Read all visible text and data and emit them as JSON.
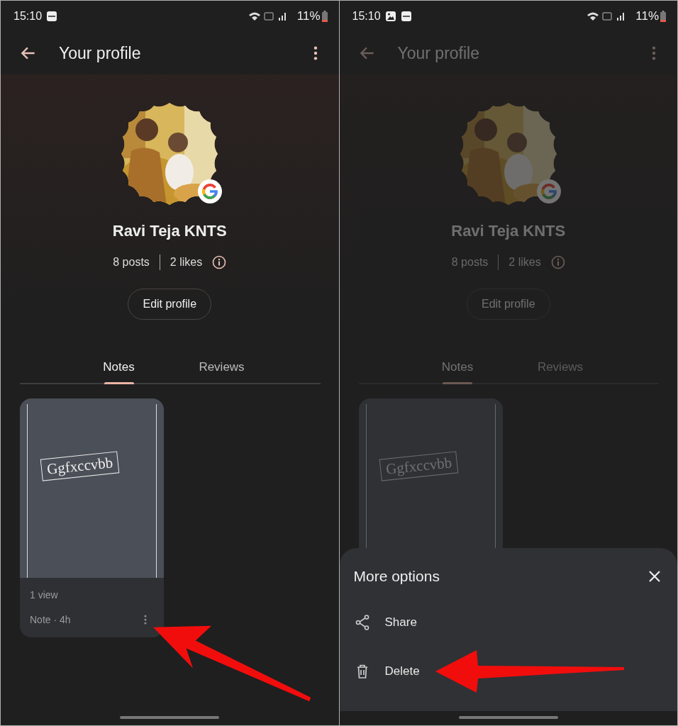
{
  "panels": [
    {
      "dimmed": false,
      "status_bar": {
        "time": "15:10",
        "notification_icons": [
          {
            "kind": "app"
          }
        ],
        "battery": "11%"
      },
      "app_bar": {
        "title": "Your profile"
      },
      "profile": {
        "name": "Ravi Teja KNTS",
        "posts": "8 posts",
        "likes": "2 likes",
        "edit_button": "Edit profile"
      },
      "tabs": [
        {
          "label": "Notes",
          "selected": true
        },
        {
          "label": "Reviews",
          "selected": false
        }
      ],
      "notes": [
        {
          "preview_text": "Ggfxccvbb",
          "views": "1 view",
          "meta": "Note · 4h"
        }
      ]
    },
    {
      "dimmed": true,
      "status_bar": {
        "time": "15:10",
        "notification_icons": [
          {
            "kind": "gallery"
          },
          {
            "kind": "app"
          }
        ],
        "battery": "11%"
      },
      "app_bar": {
        "title": "Your profile"
      },
      "profile": {
        "name": "Ravi Teja KNTS",
        "posts": "8 posts",
        "likes": "2 likes",
        "edit_button": "Edit profile"
      },
      "tabs": [
        {
          "label": "Notes",
          "selected": true
        },
        {
          "label": "Reviews",
          "selected": false
        }
      ],
      "notes": [
        {
          "preview_text": "Ggfxccvbb"
        }
      ],
      "sheet": {
        "title": "More options",
        "items": [
          {
            "kind": "share",
            "label": "Share"
          },
          {
            "kind": "delete",
            "label": "Delete"
          }
        ]
      }
    }
  ]
}
